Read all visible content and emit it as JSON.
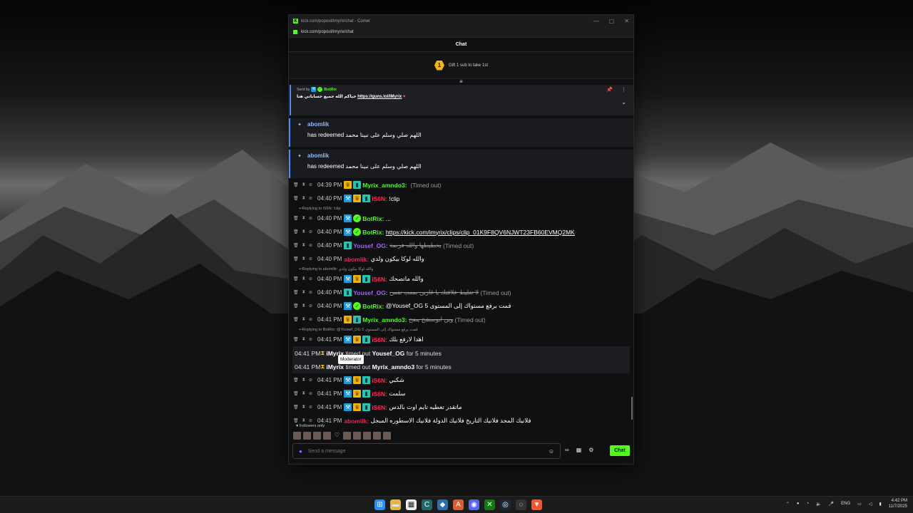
{
  "window": {
    "title": "kick.com/popout/imyrix/chat - Comet",
    "url": "kick.com/popout/imyrix/chat",
    "controls": [
      "—",
      "▢",
      "✕"
    ]
  },
  "chat": {
    "header": "Chat",
    "gift_badge": "1",
    "gift_text": "Gift 1 sub to take 1st"
  },
  "pinned": {
    "sent_by_label": "Sent by",
    "sender": "BotRix",
    "message_prefix": "حياكم الله جميع حساباتي هنا",
    "link": "https://guns.lol/iMyrix",
    "heart": "♥"
  },
  "redeems": [
    {
      "user": "abomlik",
      "text": "has redeemed اللهم صلي وسلم على نبينا محمد"
    },
    {
      "user": "abomlik",
      "text": "has redeemed اللهم صلي وسلم على نبينا محمد"
    }
  ],
  "messages": [
    {
      "type": "msg",
      "time": "04:39 PM",
      "user": "Myrix_amndo3",
      "user_color": "green",
      "badges": [
        "crown",
        "sub"
      ],
      "text": "",
      "suffix": "(Timed out)",
      "strike": false
    },
    {
      "type": "msg",
      "time": "04:40 PM",
      "user": "iS6N",
      "user_color": "red",
      "badges": [
        "mod",
        "crown",
        "sub"
      ],
      "text": "!clip",
      "suffix": "",
      "strike": false
    },
    {
      "type": "reply",
      "text": "Replying to iS6N: !clip"
    },
    {
      "type": "msg",
      "time": "04:40 PM",
      "user": "BotRix",
      "user_color": "green",
      "badges": [
        "mod",
        "ver"
      ],
      "text": "...",
      "suffix": "",
      "strike": false
    },
    {
      "type": "msg",
      "time": "04:40 PM",
      "user": "BotRix",
      "user_color": "green",
      "badges": [
        "mod",
        "ver"
      ],
      "text": "https://kick.com/imyrix/clips/clip_01K9F8QV6NJWT23FB60EVMQ2MK",
      "suffix": "",
      "strike": false,
      "link": true
    },
    {
      "type": "msg",
      "time": "04:40 PM",
      "user": "Yousef_OG",
      "user_color": "purple",
      "badges": [
        "sub"
      ],
      "text": "يخطيطها والله فرصة",
      "suffix": "(Timed out)",
      "strike": true
    },
    {
      "type": "msg",
      "time": "04:40 PM",
      "user": "abomlik",
      "user_color": "pink",
      "badges": [],
      "text": "والله لوكا بيكون ولدي",
      "suffix": "",
      "strike": false
    },
    {
      "type": "reply",
      "text": "Replying to abomlik: والله لوكا بيكون ولدي"
    },
    {
      "type": "msg",
      "time": "04:40 PM",
      "user": "iS6N",
      "user_color": "red",
      "badges": [
        "mod",
        "crown",
        "sub"
      ],
      "text": "والله ماتصحك",
      "suffix": "",
      "strike": false
    },
    {
      "type": "msg",
      "time": "04:40 PM",
      "user": "Yousef_OG",
      "user_color": "purple",
      "badges": [
        "sub"
      ],
      "text": "لا تغليط علاقتك يا غازين صعب نفس",
      "suffix": "(Timed out)",
      "strike": true
    },
    {
      "type": "msg",
      "time": "04:40 PM",
      "user": "BotRix",
      "user_color": "green",
      "badges": [
        "mod",
        "ver"
      ],
      "text": "@Yousef_OG قمت برفع مستواك إلى المستوى 5",
      "suffix": "",
      "strike": false
    },
    {
      "type": "msg",
      "time": "04:41 PM",
      "user": "Myrix_amndo3",
      "user_color": "green",
      "badges": [
        "crown",
        "sub"
      ],
      "text": "وين ابوسشخ يضح",
      "suffix": "(Timed out)",
      "strike": true
    },
    {
      "type": "reply",
      "text": "Replying to BotRix: @Yousef_OG 5 قمت برفع مستواك إلى المستوى"
    },
    {
      "type": "msg",
      "time": "04:41 PM",
      "user": "iS6N",
      "user_color": "red",
      "badges": [
        "mod",
        "crown",
        "sub"
      ],
      "text": "اهدا لارفع بلك",
      "suffix": "",
      "strike": false
    },
    {
      "type": "mod",
      "time": "04:41 PM",
      "actor": "iMyrix",
      "action": "timed out",
      "target": "Yousef_OG",
      "duration": "for 5 minutes"
    },
    {
      "type": "mod",
      "time": "04:41 PM",
      "actor": "iMyrix",
      "action": "timed out",
      "target": "Myrix_amndo3",
      "duration": "for 5 minutes"
    },
    {
      "type": "msg",
      "time": "04:41 PM",
      "user": "iS6N",
      "user_color": "red",
      "badges": [
        "mod",
        "crown",
        "sub"
      ],
      "text": "شكبي",
      "suffix": "",
      "strike": false
    },
    {
      "type": "msg",
      "time": "04:41 PM",
      "user": "iS6N",
      "user_color": "red",
      "badges": [
        "mod",
        "crown",
        "sub"
      ],
      "text": "سلمت",
      "suffix": "",
      "strike": false
    },
    {
      "type": "msg",
      "time": "04:41 PM",
      "user": "iS6N",
      "user_color": "red",
      "badges": [
        "mod",
        "crown",
        "sub"
      ],
      "text": "ماتقدر تعطيه تايم اوت بالدس",
      "suffix": "",
      "strike": false
    },
    {
      "type": "msg",
      "time": "04:41 PM",
      "user": "abomlik",
      "user_color": "pink",
      "badges": [],
      "text": "فلانيك المجد فلانيك التاريخ فلانيك الدولة فلانيك الاسطوره المبجل",
      "suffix": "",
      "strike": false
    }
  ],
  "tooltip": "Moderator",
  "followers_only": "Followers only",
  "input": {
    "placeholder": "Send a message"
  },
  "send_button": "Chat",
  "taskbar": {
    "lang": "ENG",
    "time": "4:42 PM",
    "date": "11/7/2025"
  },
  "colors": {
    "kick_green": "#53fc18",
    "mod_blue": "#1a9ad8",
    "accent_blue": "#4a8cff",
    "red_name": "#ff2a55",
    "purple_name": "#b15aff"
  }
}
